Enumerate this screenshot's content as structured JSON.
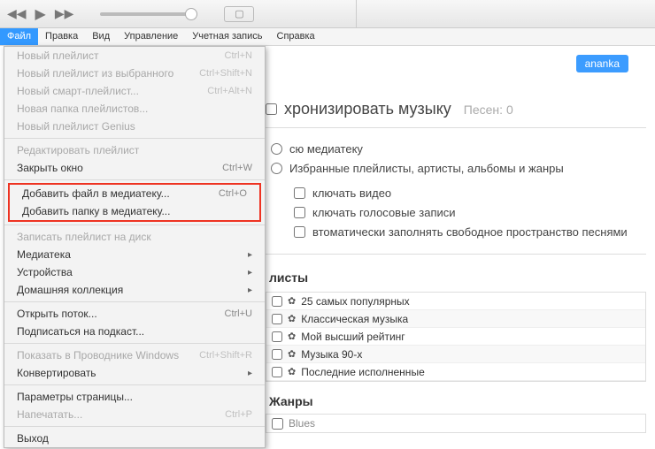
{
  "menubar": {
    "items": [
      "Файл",
      "Правка",
      "Вид",
      "Управление",
      "Учетная запись",
      "Справка"
    ],
    "active_index": 0
  },
  "file_menu": {
    "g1": [
      {
        "label": "Новый плейлист",
        "shortcut": "Ctrl+N",
        "disabled": true
      },
      {
        "label": "Новый плейлист из выбранного",
        "shortcut": "Ctrl+Shift+N",
        "disabled": true
      },
      {
        "label": "Новый смарт-плейлист...",
        "shortcut": "Ctrl+Alt+N",
        "disabled": true
      },
      {
        "label": "Новая папка плейлистов...",
        "shortcut": "",
        "disabled": true
      },
      {
        "label": "Новый плейлист Genius",
        "shortcut": "",
        "disabled": true
      }
    ],
    "g2": [
      {
        "label": "Редактировать плейлист",
        "shortcut": "",
        "disabled": true
      },
      {
        "label": "Закрыть окно",
        "shortcut": "Ctrl+W",
        "disabled": false
      }
    ],
    "g3_highlight": [
      {
        "label": "Добавить файл в медиатеку...",
        "shortcut": "Ctrl+O",
        "disabled": false
      },
      {
        "label": "Добавить папку в медиатеку...",
        "shortcut": "",
        "disabled": false
      }
    ],
    "g4": [
      {
        "label": "Записать плейлист на диск",
        "shortcut": "",
        "disabled": true
      },
      {
        "label": "Медиатека",
        "submenu": true,
        "disabled": false
      },
      {
        "label": "Устройства",
        "submenu": true,
        "disabled": false
      },
      {
        "label": "Домашняя коллекция",
        "submenu": true,
        "disabled": false
      }
    ],
    "g5": [
      {
        "label": "Открыть поток...",
        "shortcut": "Ctrl+U",
        "disabled": false
      },
      {
        "label": "Подписаться на подкаст...",
        "shortcut": "",
        "disabled": false
      }
    ],
    "g6": [
      {
        "label": "Показать в Проводнике Windows",
        "shortcut": "Ctrl+Shift+R",
        "disabled": true
      },
      {
        "label": "Конвертировать",
        "submenu": true,
        "disabled": false
      }
    ],
    "g7": [
      {
        "label": "Параметры страницы...",
        "shortcut": "",
        "disabled": false
      },
      {
        "label": "Напечатать...",
        "shortcut": "Ctrl+P",
        "disabled": true
      }
    ],
    "g8": [
      {
        "label": "Выход",
        "shortcut": "",
        "disabled": false
      }
    ]
  },
  "content": {
    "device_name": "ananka",
    "sync_title_partial": "хронизировать музыку",
    "song_count_label": "Песен: 0",
    "radio_whole": "сю медиатеку",
    "radio_selected": "Избранные плейлисты, артисты, альбомы и жанры",
    "cb_video": "ключать видео",
    "cb_voice": "ключать голосовые записи",
    "cb_autofill": "втоматически заполнять свободное пространство песнями",
    "playlists_title": "листы",
    "playlists": [
      "25 самых популярных",
      "Классическая музыка",
      "Мой высший рейтинг",
      "Музыка 90-х",
      "Последние исполненные"
    ],
    "genres_title": "Жанры",
    "genre_item": "Blues"
  }
}
